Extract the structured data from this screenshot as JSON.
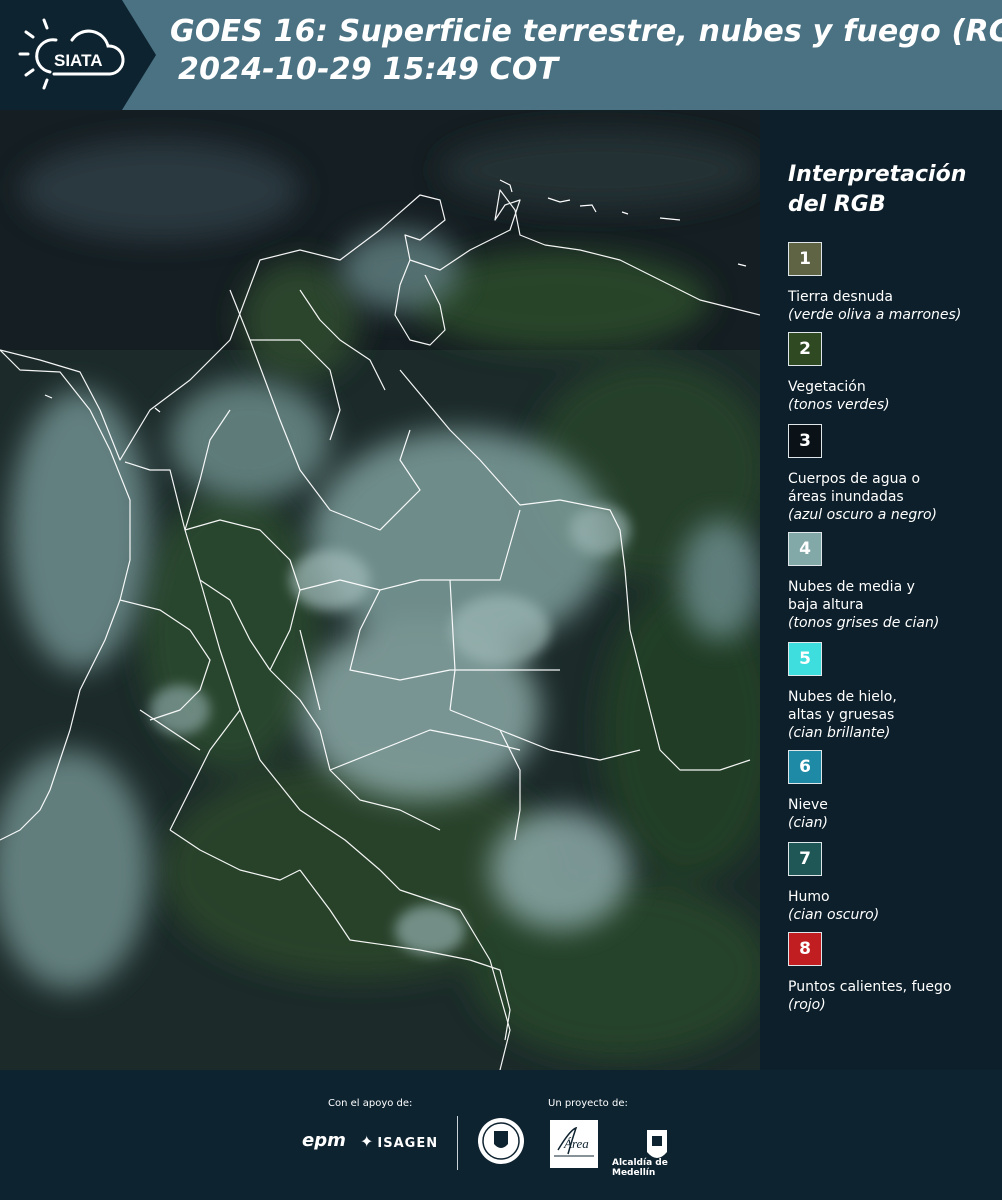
{
  "header": {
    "logo_text": "SIATA",
    "title_line1": "GOES 16: Superficie terrestre, nubes y fuego (RGB)",
    "title_line2": "2024-10-29 15:49 COT"
  },
  "legend": {
    "title": "Interpretación del RGB",
    "items": [
      {
        "number": "1",
        "label": "Tierra desnuda",
        "note": "(verde oliva a marrones)",
        "color": "#5e6444"
      },
      {
        "number": "2",
        "label": "Vegetación",
        "note": "(tonos verdes)",
        "color": "#2f4a22"
      },
      {
        "number": "3",
        "label": "Cuerpos de agua o áreas inundadas",
        "note": "(azul oscuro a negro)",
        "color": "#0a1218"
      },
      {
        "number": "4",
        "label": "Nubes de media y baja altura",
        "note": "(tonos grises de cian)",
        "color": "#82a8a8"
      },
      {
        "number": "5",
        "label": "Nubes de hielo, altas y gruesas",
        "note": "(cian brillante)",
        "color": "#3fdede"
      },
      {
        "number": "6",
        "label": "Nieve",
        "note": "(cian)",
        "color": "#1f8aa6"
      },
      {
        "number": "7",
        "label": "Humo",
        "note": "(cian oscuro)",
        "color": "#1f5757"
      },
      {
        "number": "8",
        "label": "Puntos calientes, fuego",
        "note": "(rojo)",
        "color": "#c01e20"
      }
    ]
  },
  "footer": {
    "support_caption": "Con el apoyo de:",
    "project_caption": "Un proyecto de:",
    "epm": "epm",
    "isagen": "ISAGEN",
    "area_metropolitana": "Área",
    "alcaldia": "Alcaldía de Medellín"
  }
}
